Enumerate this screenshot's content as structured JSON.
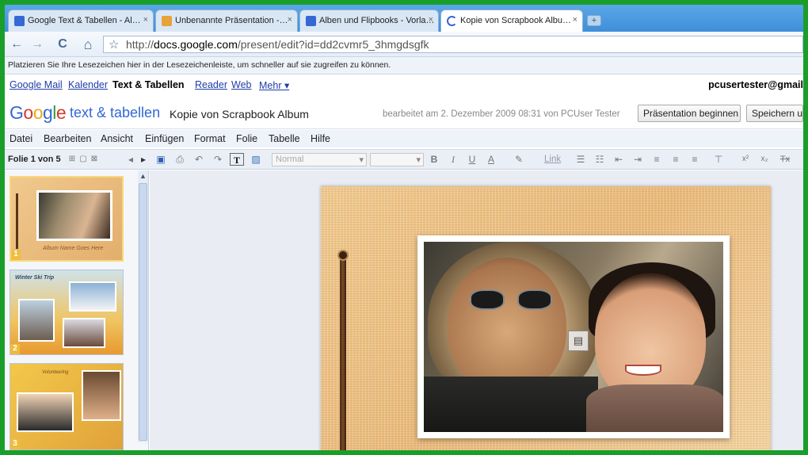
{
  "tabs": [
    {
      "label": "Google Text & Tabellen - Al…",
      "icon": "google-docs-icon",
      "color": "#3468d4"
    },
    {
      "label": "Unbenannte Präsentation -…",
      "icon": "presentation-icon",
      "color": "#e8a23a"
    },
    {
      "label": "Alben und Flipbooks - Vorla…",
      "icon": "google-docs-icon",
      "color": "#3468d4"
    },
    {
      "label": "Kopie von Scrapbook Albu…",
      "icon": "loading-icon",
      "color": "#3468d4"
    }
  ],
  "close_glyph": "×",
  "newtab_glyph": "+",
  "nav": {
    "back": "←",
    "forward": "→",
    "reload": "C",
    "home": "⌂",
    "star": "☆"
  },
  "url": {
    "prefix": "http://",
    "host": "docs.google.com",
    "path": "/present/edit?id=dd2cvmr5_3hmgdsgfk"
  },
  "bookmarks_hint": "Platzieren Sie Ihre Lesezeichen hier in der Lesezeichenleiste, um schneller auf sie zugreifen zu können.",
  "gbar": {
    "links": [
      "Google Mail",
      "Kalender",
      "Reader",
      "Web",
      "Mehr ▾"
    ],
    "current": "Text & Tabellen",
    "user": "pcusertester@gmail"
  },
  "header": {
    "logo": [
      "G",
      "o",
      "o",
      "g",
      "l",
      "e"
    ],
    "product": "text & tabellen",
    "title": "Kopie von Scrapbook Album",
    "edited": "bearbeitet am 2. Dezember 2009 08:31 von PCUser Tester",
    "start_button": "Präsentation beginnen",
    "save_button": "Speichern u"
  },
  "menu": [
    "Datei",
    "Bearbeiten",
    "Ansicht",
    "Einfügen",
    "Format",
    "Folie",
    "Tabelle",
    "Hilfe"
  ],
  "toolbar": {
    "slide_count": "Folie 1 von 5",
    "font_select": "Normal",
    "size_select": "",
    "link": "Link",
    "icons": {
      "bold": "B",
      "italic": "I",
      "underline": "U",
      "text": "T",
      "textcolor": "A",
      "superscript": "x²",
      "subscript": "x₂",
      "clear": "Tx"
    }
  },
  "slides": [
    {
      "num": "1",
      "caption": "Album Name Goes Here"
    },
    {
      "num": "2",
      "caption": "Winter Ski Trip"
    },
    {
      "num": "3",
      "caption": "Volunteering"
    }
  ],
  "scroll_up": "▲",
  "overlay_glyph": "▤"
}
